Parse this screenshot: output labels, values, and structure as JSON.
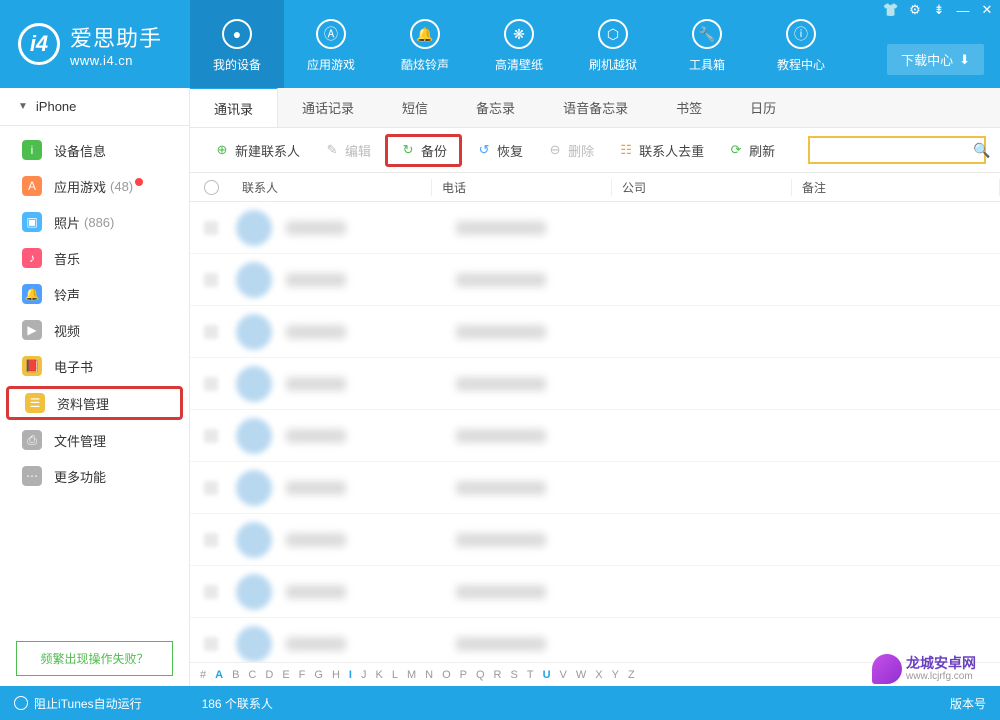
{
  "header": {
    "logo_title": "爱思助手",
    "logo_url": "www.i4.cn",
    "download_btn": "下载中心"
  },
  "nav": [
    {
      "label": "我的设备",
      "icon": "apple"
    },
    {
      "label": "应用游戏",
      "icon": "app"
    },
    {
      "label": "酷炫铃声",
      "icon": "bell"
    },
    {
      "label": "高清壁纸",
      "icon": "flower"
    },
    {
      "label": "刷机越狱",
      "icon": "box"
    },
    {
      "label": "工具箱",
      "icon": "wrench"
    },
    {
      "label": "教程中心",
      "icon": "info"
    }
  ],
  "sidebar": {
    "device": "iPhone",
    "items": [
      {
        "label": "设备信息",
        "color": "#4dbd4d",
        "glyph": "i"
      },
      {
        "label": "应用游戏",
        "color": "#ff8a4d",
        "glyph": "A",
        "count": "(48)",
        "dot": true
      },
      {
        "label": "照片",
        "color": "#4db8ff",
        "glyph": "▣",
        "count": "(886)"
      },
      {
        "label": "音乐",
        "color": "#ff5a7a",
        "glyph": "♪"
      },
      {
        "label": "铃声",
        "color": "#4da0ff",
        "glyph": "🔔"
      },
      {
        "label": "视频",
        "color": "#b0b0b0",
        "glyph": "▶"
      },
      {
        "label": "电子书",
        "color": "#f0c040",
        "glyph": "📕"
      },
      {
        "label": "资料管理",
        "color": "#f0c040",
        "glyph": "☰",
        "highlighted": true
      },
      {
        "label": "文件管理",
        "color": "#b0b0b0",
        "glyph": "⎙"
      },
      {
        "label": "更多功能",
        "color": "#b0b0b0",
        "glyph": "⋯"
      }
    ],
    "help": "频繁出现操作失败？"
  },
  "sub_tabs": [
    "通讯录",
    "通话记录",
    "短信",
    "备忘录",
    "语音备忘录",
    "书签",
    "日历"
  ],
  "toolbar": {
    "new_contact": "新建联系人",
    "edit": "编辑",
    "backup": "备份",
    "restore": "恢复",
    "delete": "删除",
    "dedupe": "联系人去重",
    "refresh": "刷新"
  },
  "table": {
    "cols": {
      "contact": "联系人",
      "phone": "电话",
      "company": "公司",
      "note": "备注"
    }
  },
  "alpha": [
    "#",
    "A",
    "B",
    "C",
    "D",
    "E",
    "F",
    "G",
    "H",
    "I",
    "J",
    "K",
    "L",
    "M",
    "N",
    "O",
    "P",
    "Q",
    "R",
    "S",
    "T",
    "U",
    "V",
    "W",
    "X",
    "Y",
    "Z"
  ],
  "footer": {
    "left": "阻止iTunes自动运行",
    "center": "186 个联系人",
    "right": "版本号"
  },
  "watermark": {
    "cn": "龙城安卓网",
    "url": "www.lcjrfg.com"
  }
}
